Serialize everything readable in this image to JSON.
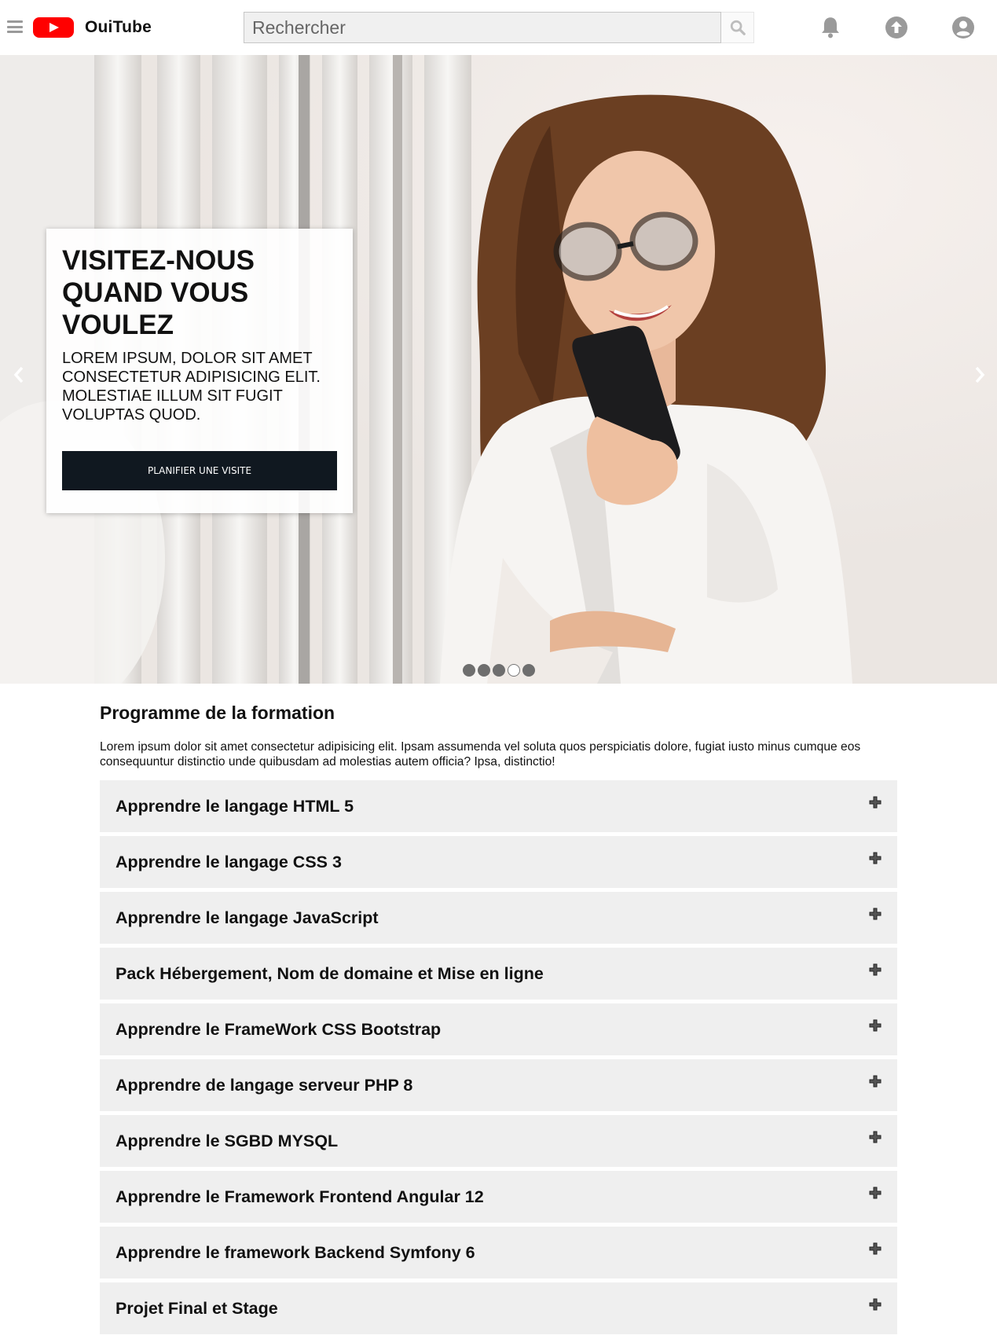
{
  "header": {
    "brand": "OuiTube",
    "search_placeholder": "Rechercher"
  },
  "hero": {
    "title": "VISITEZ-NOUS QUAND VOUS VOULEZ",
    "text": "LOREM IPSUM, DOLOR SIT AMET CONSECTETUR ADIPISICING ELIT. MOLESTIAE ILLUM SIT FUGIT VOLUPTAS QUOD.",
    "cta_label": "PLANIFIER UNE VISITE",
    "prev_glyph": "‹",
    "next_glyph": "›",
    "slide_count": 5,
    "active_slide": 4
  },
  "programme": {
    "title": "Programme de la formation",
    "intro": "Lorem ipsum dolor sit amet consectetur adipisicing elit. Ipsam assumenda vel soluta quos perspiciatis dolore, fugiat iusto minus cumque eos consequuntur distinctio unde quibusdam ad molestias autem officia? Ipsa, distinctio!",
    "items": [
      {
        "label": "Apprendre le langage HTML 5"
      },
      {
        "label": "Apprendre le langage CSS 3"
      },
      {
        "label": "Apprendre le langage JavaScript"
      },
      {
        "label": "Pack Hébergement, Nom de domaine et Mise en ligne"
      },
      {
        "label": "Apprendre le FrameWork CSS Bootstrap"
      },
      {
        "label": "Apprendre de langage serveur PHP 8"
      },
      {
        "label": "Apprendre le SGBD MYSQL"
      },
      {
        "label": "Apprendre le Framework Frontend Angular 12"
      },
      {
        "label": "Apprendre le framework Backend Symfony 6"
      },
      {
        "label": "Projet Final et Stage"
      }
    ]
  },
  "colors": {
    "brand_red": "#ff0000",
    "cta_bg": "#101820",
    "accordion_bg": "#efefef",
    "icon_gray": "#9a9a9a"
  },
  "icons": {
    "menu": "menu-icon",
    "logo": "play-logo-icon",
    "search": "search-icon",
    "notifications": "bell-icon",
    "upload": "upload-icon",
    "account": "account-icon",
    "expand": "plus-icon"
  }
}
